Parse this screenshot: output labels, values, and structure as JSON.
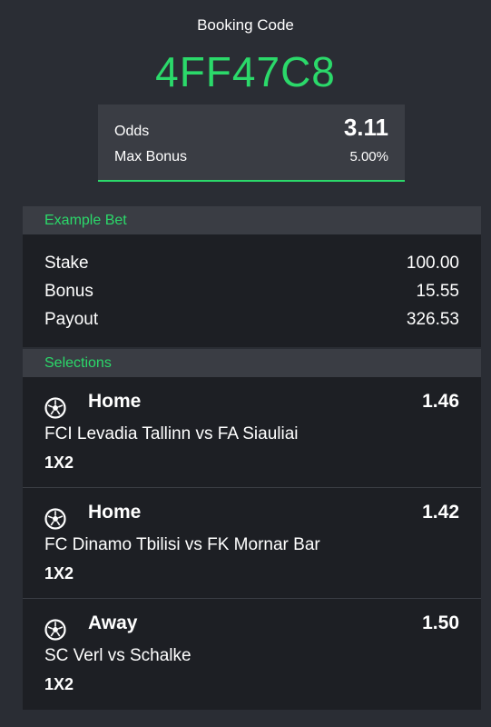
{
  "booking": {
    "label": "Booking Code",
    "code": "4FF47C8"
  },
  "summary": {
    "odds_label": "Odds",
    "odds_value": "3.11",
    "bonus_label": "Max Bonus",
    "bonus_value": "5.00%"
  },
  "example_bet": {
    "title": "Example Bet",
    "rows": [
      {
        "label": "Stake",
        "value": "100.00"
      },
      {
        "label": "Bonus",
        "value": "15.55"
      },
      {
        "label": "Payout",
        "value": "326.53"
      }
    ]
  },
  "selections": {
    "title": "Selections",
    "icon": "soccer-ball-icon",
    "items": [
      {
        "pick": "Home",
        "odds": "1.46",
        "match": "FCI Levadia Tallinn vs FA Siauliai",
        "market": "1X2"
      },
      {
        "pick": "Home",
        "odds": "1.42",
        "match": "FC Dinamo Tbilisi vs FK Mornar Bar",
        "market": "1X2"
      },
      {
        "pick": "Away",
        "odds": "1.50",
        "match": "SC Verl vs Schalke",
        "market": "1X2"
      }
    ]
  },
  "colors": {
    "accent": "#2bd96a",
    "background": "#2a2d34",
    "panel": "#1d1f24",
    "header": "#3a3d44"
  }
}
